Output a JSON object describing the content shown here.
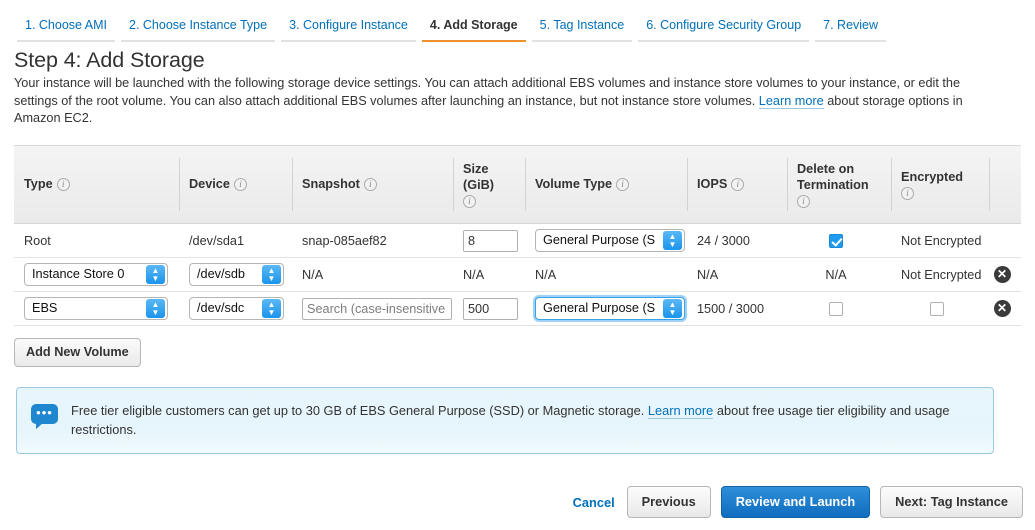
{
  "wizard": {
    "tabs": [
      {
        "label": "1. Choose AMI",
        "active": false
      },
      {
        "label": "2. Choose Instance Type",
        "active": false
      },
      {
        "label": "3. Configure Instance",
        "active": false
      },
      {
        "label": "4. Add Storage",
        "active": true
      },
      {
        "label": "5. Tag Instance",
        "active": false
      },
      {
        "label": "6. Configure Security Group",
        "active": false
      },
      {
        "label": "7. Review",
        "active": false
      }
    ]
  },
  "page": {
    "title": "Step 4: Add Storage",
    "intro_part1": "Your instance will be launched with the following storage device settings. You can attach additional EBS volumes and instance store volumes to your instance, or edit the settings of the root volume. You can also attach additional EBS volumes after launching an instance, but not instance store volumes. ",
    "intro_link": "Learn more",
    "intro_part2": " about storage options in Amazon EC2."
  },
  "table": {
    "headers": {
      "type": "Type",
      "device": "Device",
      "snapshot": "Snapshot",
      "size": "Size (GiB)",
      "size_line1": "Size",
      "size_line2": "(GiB)",
      "volume_type": "Volume Type",
      "iops": "IOPS",
      "delete_line1": "Delete on",
      "delete_line2": "Termination",
      "encrypted": "Encrypted"
    },
    "info_glyph": "i",
    "rows": [
      {
        "type": "Root",
        "type_control": "text",
        "device": "/dev/sda1",
        "device_control": "text",
        "snapshot": "snap-085aef82",
        "snapshot_control": "text",
        "size": "8",
        "size_control": "input",
        "volume_type": "General Purpose (S",
        "volume_type_control": "select",
        "volume_type_focused": false,
        "iops": "24 / 3000",
        "delete_on_termination": "checked",
        "encrypted": "Not Encrypted",
        "encrypted_control": "text",
        "removable": false
      },
      {
        "type": "Instance Store 0",
        "type_control": "select",
        "device": "/dev/sdb",
        "device_control": "select",
        "snapshot": "N/A",
        "snapshot_control": "text",
        "size": "N/A",
        "size_control": "text",
        "volume_type": "N/A",
        "volume_type_control": "text",
        "volume_type_focused": false,
        "iops": "N/A",
        "delete_on_termination": "N/A",
        "encrypted": "Not Encrypted",
        "encrypted_control": "text",
        "removable": true
      },
      {
        "type": "EBS",
        "type_control": "select",
        "device": "/dev/sdc",
        "device_control": "select",
        "snapshot": "Search (case-insensitive",
        "snapshot_control": "input-placeholder",
        "size": "500",
        "size_control": "input",
        "volume_type": "General Purpose (S",
        "volume_type_control": "select",
        "volume_type_focused": true,
        "iops": "1500 / 3000",
        "delete_on_termination": "unchecked",
        "encrypted": "unchecked",
        "encrypted_control": "checkbox",
        "removable": true
      }
    ],
    "remove_glyph": "✕"
  },
  "actions": {
    "add_new_volume": "Add New Volume"
  },
  "notice": {
    "icon_dots": "•••",
    "text_part1": "Free tier eligible customers can get up to 30 GB of EBS General Purpose (SSD) or Magnetic storage. ",
    "link": "Learn more",
    "text_part2": " about free usage tier eligibility and usage restrictions."
  },
  "footer": {
    "cancel": "Cancel",
    "previous": "Previous",
    "review_and_launch": "Review and Launch",
    "next": "Next: Tag Instance"
  },
  "colors": {
    "accent_blue": "#0070ba",
    "active_tab_underline": "#ec912d",
    "primary_button": "#0f6cc0",
    "checkbox_checked": "#1f9bf0"
  }
}
